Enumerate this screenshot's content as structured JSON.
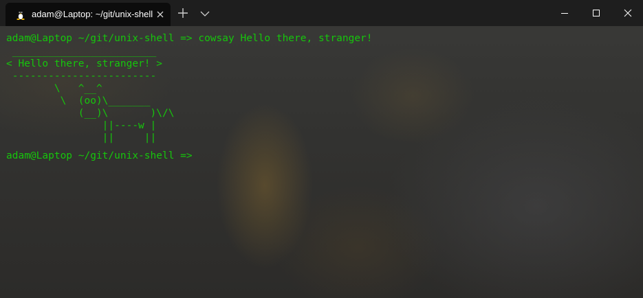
{
  "window": {
    "tab_title": "adam@Laptop: ~/git/unix-shell",
    "tab_icon": "linux-penguin-icon",
    "new_tab_icon": "plus-icon",
    "dropdown_icon": "chevron-down-icon",
    "controls": [
      "minimize-icon",
      "maximize-icon",
      "close-icon"
    ]
  },
  "colors": {
    "terminal_text": "#16c60c",
    "titlebar": "#1e1e1e",
    "active_tab": "#0c0c0c"
  },
  "terminal": {
    "lines": [
      "adam@Laptop ~/git/unix-shell => cowsay Hello there, stranger!",
      " ________________________",
      "< Hello there, stranger! >",
      " ------------------------",
      "        \\   ^__^",
      "         \\  (oo)\\_______",
      "            (__)\\       )\\/\\",
      "                ||----w |",
      "                ||     ||",
      "adam@Laptop ~/git/unix-shell =>"
    ]
  }
}
